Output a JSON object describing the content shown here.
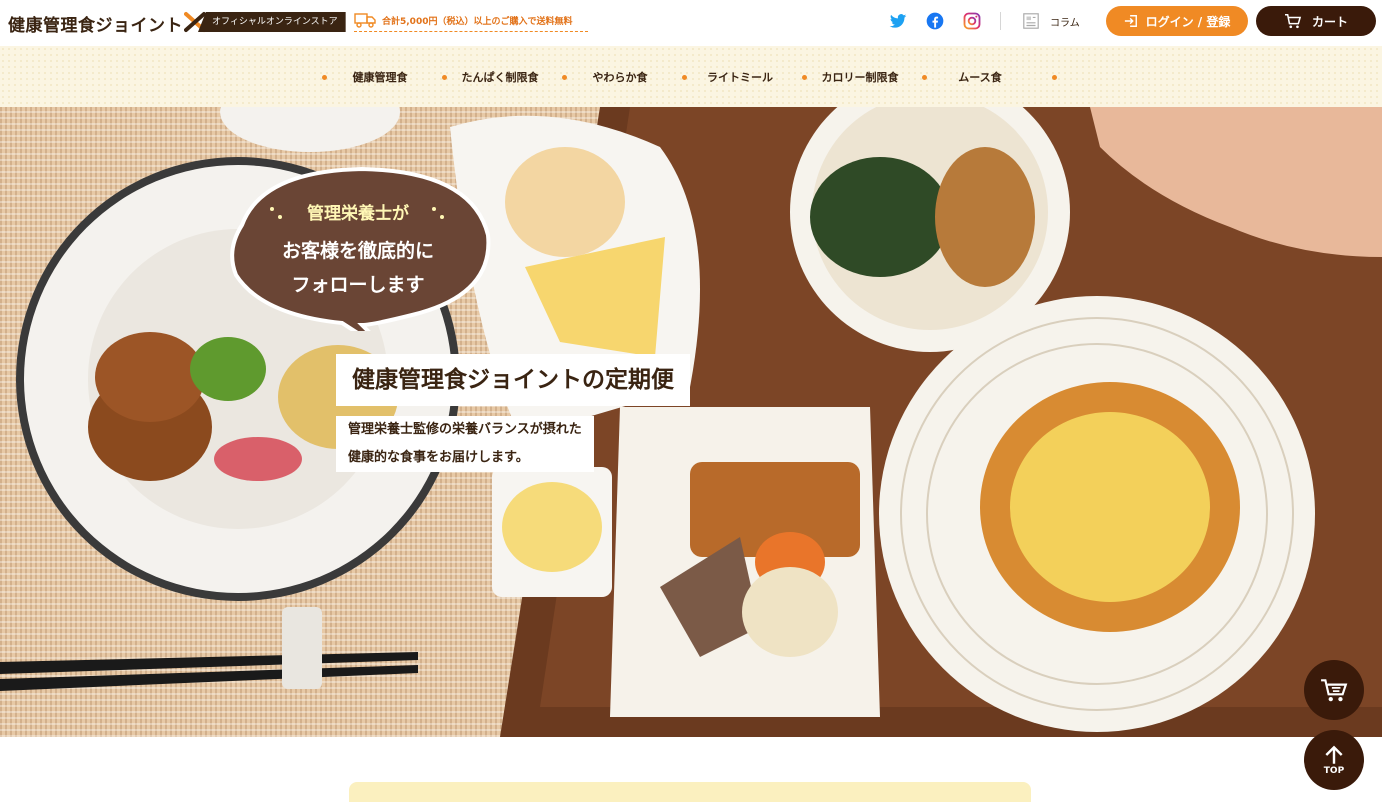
{
  "header": {
    "logo_text": "健康管理食ジョイント",
    "store_badge": "オフィシャルオンラインストア",
    "shipping_text": "合計5,000円（税込）以上のご購入で送料無料",
    "column_label": "コラム",
    "login_label": "ログイン / 登録",
    "cart_label": "カート"
  },
  "nav": {
    "categories": [
      {
        "label": "健康管理食"
      },
      {
        "label": "たんぱく制限食"
      },
      {
        "label": "やわらか食"
      },
      {
        "label": "ライトミール"
      },
      {
        "label": "カロリー制限食"
      },
      {
        "label": "ムース食"
      }
    ]
  },
  "hero": {
    "bubble_line1": "管理栄養士が",
    "bubble_line2": "お客様を徹底的に",
    "bubble_line3": "フォローします",
    "title": "健康管理食ジョイントの定期便",
    "subtitle_line1": "管理栄養士監修の栄養バランスが摂れた",
    "subtitle_line2": "健康的な食事をお届けします。"
  },
  "floating": {
    "top_label": "TOP"
  },
  "colors": {
    "brand_brown": "#3a2412",
    "accent_orange": "#f08a24",
    "nav_bg": "#fbf5e2"
  },
  "icons": [
    "twitter-icon",
    "facebook-icon",
    "instagram-icon",
    "column-icon",
    "login-icon",
    "cart-icon",
    "truck-icon",
    "arrow-up-icon"
  ]
}
